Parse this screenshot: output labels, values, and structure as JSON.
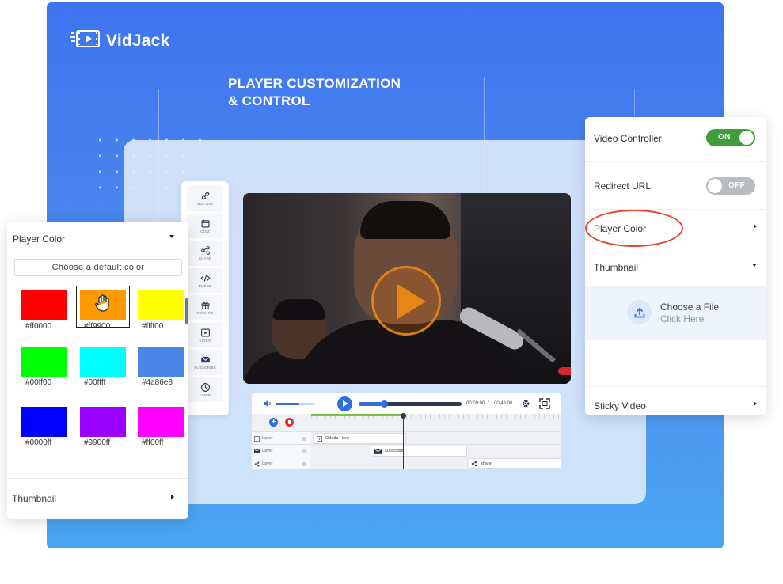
{
  "brand": {
    "name": "VidJack"
  },
  "headline": {
    "line1": "PLAYER CUSTOMIZATION",
    "line2": "& CONTROL"
  },
  "toolbar": {
    "items": [
      {
        "label": "BUTTON",
        "icon": "link-icon"
      },
      {
        "label": "QUIZ",
        "icon": "calendar-icon"
      },
      {
        "label": "SHARE",
        "icon": "share-icon"
      },
      {
        "label": "EMBED",
        "icon": "code-icon"
      },
      {
        "label": "REWARD",
        "icon": "gift-icon"
      },
      {
        "label": "VIDEO",
        "icon": "video-icon"
      },
      {
        "label": "SUBSCRIBE",
        "icon": "mail-icon"
      },
      {
        "label": "TIMER",
        "icon": "clock-icon"
      }
    ]
  },
  "player": {
    "current_time": "00:09:00",
    "separator": "/",
    "duration": "00:43:00",
    "volume_fraction": 0.6,
    "progress_fraction": 0.25
  },
  "timeline": {
    "rows": [
      {
        "name": "Layer",
        "icon": "text-icon",
        "clip": "Ododo Here",
        "clip_icon": "text-icon"
      },
      {
        "name": "Layer",
        "icon": "mail-icon",
        "clip": "subscribe",
        "clip_icon": "mail-icon"
      },
      {
        "name": "Layer",
        "icon": "share-icon",
        "clip": "share",
        "clip_icon": "share-icon"
      }
    ]
  },
  "color_panel": {
    "title": "Player Color",
    "choose_default": "Choose a default color",
    "swatches": [
      {
        "hex": "#ff0000",
        "color": "#ff0000"
      },
      {
        "hex": "#ff9900",
        "color": "#ff9900",
        "selected": true
      },
      {
        "hex": "#ffff00",
        "color": "#ffff00"
      },
      {
        "hex": "#00ff00",
        "color": "#00ff00"
      },
      {
        "hex": "#00ffff",
        "color": "#00ffff"
      },
      {
        "hex": "#4a86e8",
        "color": "#4a86e8"
      },
      {
        "hex": "#0000ff",
        "color": "#0000ff"
      },
      {
        "hex": "#9900ff",
        "color": "#9900ff"
      },
      {
        "hex": "#ff00ff",
        "color": "#ff00ff"
      }
    ],
    "thumbnail_label": "Thumbnail"
  },
  "settings_panel": {
    "video_controller": {
      "label": "Video Controller",
      "state": "ON"
    },
    "redirect_url": {
      "label": "Redirect URL",
      "state": "OFF"
    },
    "player_color": {
      "label": "Player Color"
    },
    "thumbnail": {
      "label": "Thumbnail"
    },
    "upload": {
      "title": "Choose a File",
      "subtitle": "Click Here"
    },
    "sticky_video": {
      "label": "Sticky Video"
    }
  },
  "colors": {
    "accent_blue": "#3d74ee",
    "toggle_on": "#3f9e3a",
    "toggle_off": "#b9bcc1",
    "highlight": "#e8432a",
    "player_blue": "#2f6fe0"
  }
}
